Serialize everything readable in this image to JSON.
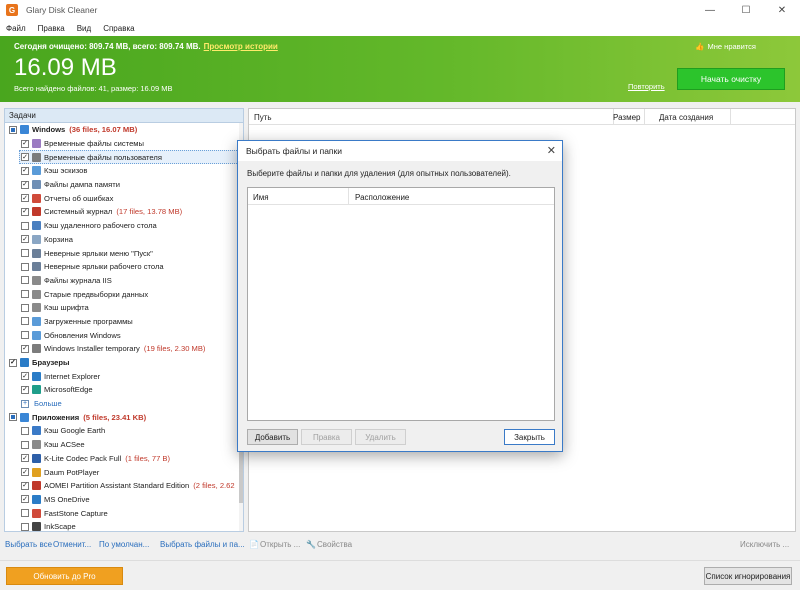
{
  "window": {
    "title": "Glary Disk Cleaner",
    "app_icon": "G",
    "minimize": "—",
    "maximize": "☐",
    "close": "✕"
  },
  "menu": [
    "Файл",
    "Правка",
    "Вид",
    "Справка"
  ],
  "header": {
    "summary_text": "Сегодня очищено: 809.74 MB, всего: 809.74 MB.",
    "history_link": "Просмотр истории",
    "big_size": "16.09 MB",
    "found_text": "Всего найдено файлов: 41, размер: 16.09 MB",
    "like_icon": "👍",
    "like_text": "Мне нравится",
    "repeat_link": "Повторить",
    "start_button": "Начать очистку"
  },
  "left_panel": {
    "heading": "Задачи",
    "rows": [
      {
        "type": "group",
        "check": "partial",
        "label": "Windows",
        "count_files": "36 files",
        "count_size": "16.07 MB",
        "icon_color": "#3a86d6"
      },
      {
        "type": "item",
        "check": "✓",
        "label": "Временные файлы системы",
        "icon_color": "#9b7bc2"
      },
      {
        "type": "item",
        "check": "✓",
        "label": "Временные файлы пользователя",
        "icon_color": "#7c7c7c",
        "selected": true
      },
      {
        "type": "item",
        "check": "✓",
        "label": "Кэш эскизов",
        "icon_color": "#5a9bd8"
      },
      {
        "type": "item",
        "check": "✓",
        "label": "Файлы дампа памяти",
        "icon_color": "#6f8fb5"
      },
      {
        "type": "item",
        "check": "✓",
        "label": "Отчеты об ошибках",
        "icon_color": "#d04a3a"
      },
      {
        "type": "item",
        "check": "✓",
        "label": "Системный журнал",
        "count_files": "17 files",
        "count_size": "13.78 MB",
        "icon_color": "#c0392b"
      },
      {
        "type": "item",
        "check": "",
        "label": "Кэш удаленного рабочего стола",
        "icon_color": "#4a7fc0"
      },
      {
        "type": "item",
        "check": "✓",
        "label": "Корзина",
        "icon_color": "#8aa6c4"
      },
      {
        "type": "item",
        "check": "",
        "label": "Неверные ярлыки меню \"Пуск\"",
        "icon_color": "#6b7f99"
      },
      {
        "type": "item",
        "check": "",
        "label": "Неверные ярлыки рабочего стола",
        "icon_color": "#6b7f99"
      },
      {
        "type": "item",
        "check": "",
        "label": "Файлы журнала IIS",
        "icon_color": "#8a8a8a"
      },
      {
        "type": "item",
        "check": "",
        "label": "Старые предвыборки данных",
        "icon_color": "#8a8a8a"
      },
      {
        "type": "item",
        "check": "",
        "label": "Кэш шрифта",
        "icon_color": "#8a8a8a"
      },
      {
        "type": "item",
        "check": "",
        "label": "Загруженные программы",
        "icon_color": "#5a9bd8"
      },
      {
        "type": "item",
        "check": "",
        "label": "Обновления Windows",
        "icon_color": "#5a9bd8"
      },
      {
        "type": "item",
        "check": "✓",
        "label": "Windows Installer temporary",
        "count_files": "19 files",
        "count_size": "2.30 MB",
        "icon_color": "#7c7c7c"
      },
      {
        "type": "group",
        "check": "✓",
        "label": "Браузеры",
        "icon_color": "#2a7cc7"
      },
      {
        "type": "item",
        "check": "✓",
        "label": "Internet Explorer",
        "icon_color": "#2a7cc7"
      },
      {
        "type": "item",
        "check": "✓",
        "label": "MicrosoftEdge",
        "icon_color": "#1f9e8a"
      },
      {
        "type": "more",
        "label": "Больше",
        "expander": "+"
      },
      {
        "type": "group",
        "check": "partial",
        "label": "Приложения",
        "count_files": "5 files",
        "count_size": "23.41 KB",
        "icon_color": "#3a86d6"
      },
      {
        "type": "item",
        "check": "",
        "label": "Кэш Google Earth",
        "icon_color": "#3a7ac7"
      },
      {
        "type": "item",
        "check": "",
        "label": "Кэш ACSee",
        "icon_color": "#8a8a8a"
      },
      {
        "type": "item",
        "check": "✓",
        "label": "K-Lite Codec Pack Full",
        "count_files": "1 files",
        "count_size": "77 B",
        "icon_color": "#2d5fa8"
      },
      {
        "type": "item",
        "check": "✓",
        "label": "Daum PotPlayer",
        "icon_color": "#e0a020"
      },
      {
        "type": "item",
        "check": "✓",
        "label": "AOMEI Partition Assistant Standard Edition",
        "count_files": "2 files",
        "count_size": "2.62",
        "icon_color": "#c0392b"
      },
      {
        "type": "item",
        "check": "✓",
        "label": "MS OneDrive",
        "icon_color": "#2a7cc7"
      },
      {
        "type": "item",
        "check": "",
        "label": "FastStone Capture",
        "icon_color": "#d04a3a"
      },
      {
        "type": "item",
        "check": "",
        "label": "InkScape",
        "icon_color": "#444444"
      }
    ]
  },
  "right_panel": {
    "col_path": "Путь",
    "col_size": "Размер",
    "col_date": "Дата создания"
  },
  "bottom_links": {
    "select_all": "Выбрать все",
    "deselect": "Отменит...",
    "default": "По умолчан...",
    "select_files": "Выбрать файлы и па...",
    "open_icon": "📄",
    "open": "Открыть ...",
    "props_icon": "🔧",
    "props": "Свойства",
    "exclude": "Исключить ..."
  },
  "footer": {
    "upgrade": "Обновить до Pro",
    "ignore": "Список игнорирования"
  },
  "dialog": {
    "title": "Выбрать файлы и папки",
    "close": "✕",
    "description": "Выберите файлы и папки для удаления (для опытных пользователей).",
    "col_name": "Имя",
    "col_location": "Расположение",
    "add": "Добавить",
    "edit": "Правка",
    "delete": "Удалить",
    "close_button": "Закрыть"
  },
  "colors": {
    "header_green": "#49a61e",
    "start_button": "#2cc42c",
    "upgrade_button": "#f0a020",
    "link_blue": "#2a6ebd",
    "count_red": "#c0392b",
    "dialog_border": "#3a7ac7"
  }
}
